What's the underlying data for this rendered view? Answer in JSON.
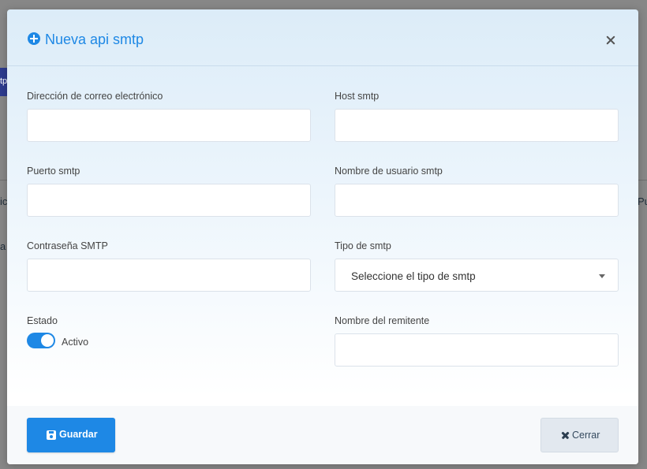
{
  "background": {
    "frag_tp": "tp",
    "frag_ic": "ic",
    "frag_pu": "Pu",
    "frag_a": "a"
  },
  "modal": {
    "title": "Nueva api smtp",
    "fields": {
      "email_label": "Dirección de correo electrónico",
      "email_value": "",
      "host_label": "Host smtp",
      "host_value": "",
      "port_label": "Puerto smtp",
      "port_value": "",
      "username_label": "Nombre de usuario smtp",
      "username_value": "",
      "password_label": "Contraseña SMTP",
      "password_value": "",
      "type_label": "Tipo de smtp",
      "type_selected": "Seleccione el tipo de smtp",
      "status_label": "Estado",
      "status_toggle_label": "Activo",
      "status_on": true,
      "sender_label": "Nombre del remitente",
      "sender_value": ""
    },
    "footer": {
      "save_label": "Guardar",
      "close_label": "Cerrar"
    }
  },
  "colors": {
    "accent": "#1e88e5",
    "text": "#444444"
  },
  "icons": {
    "title": "plus-circle-icon",
    "close": "close-icon",
    "save": "floppy-disk-icon",
    "cancel": "times-icon",
    "select": "caret-down-icon"
  }
}
